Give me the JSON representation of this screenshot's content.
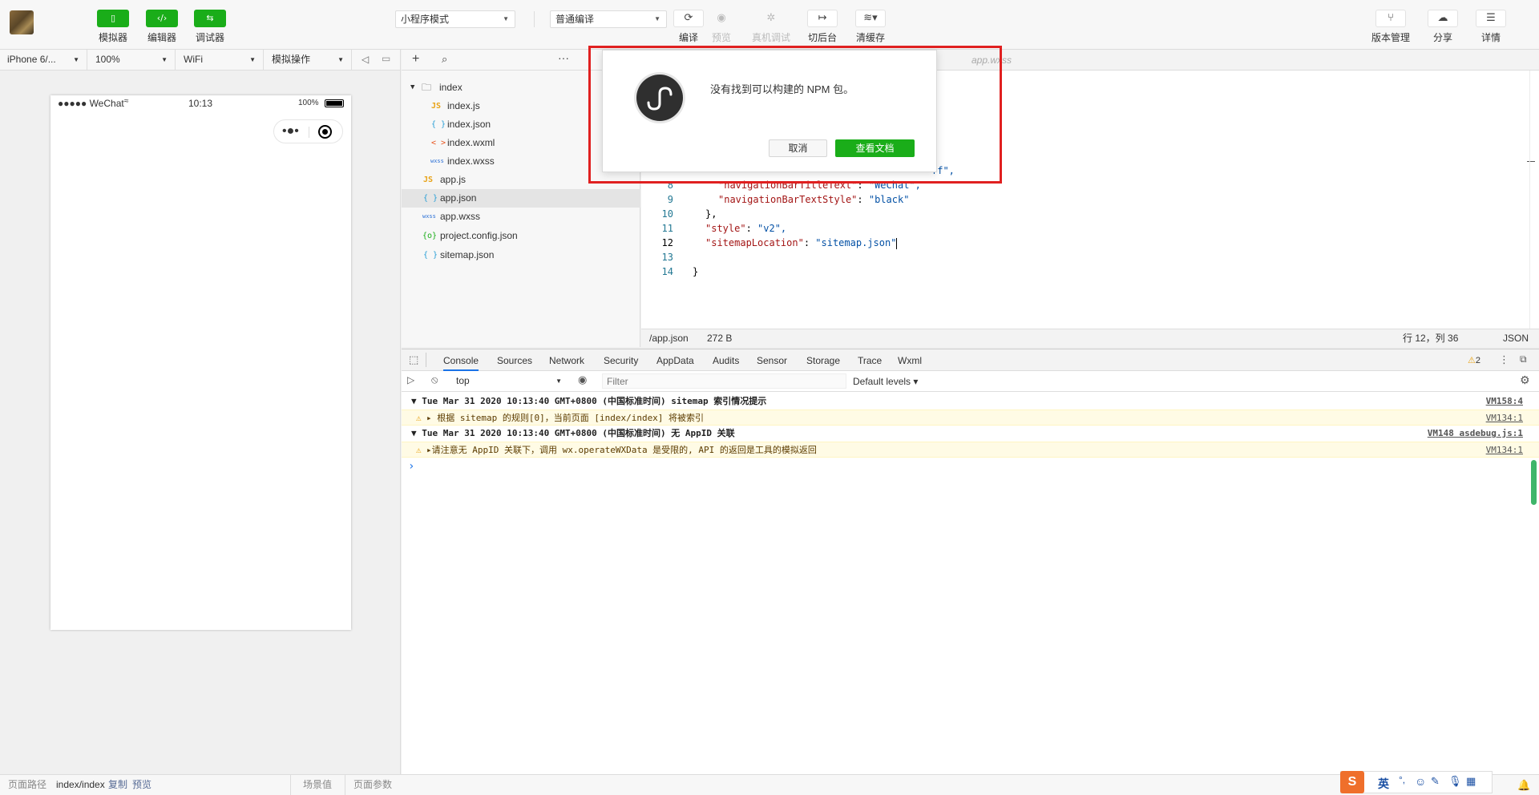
{
  "toolbar": {
    "simulator_label": "模拟器",
    "editor_label": "编辑器",
    "debugger_label": "调试器",
    "mode_select": "小程序模式",
    "compile_select": "普通编译",
    "compile_label": "编译",
    "preview_label": "预览",
    "remote_debug_label": "真机调试",
    "background_label": "切后台",
    "clear_cache_label": "清缓存",
    "version_label": "版本管理",
    "share_label": "分享",
    "details_label": "详情"
  },
  "simulator": {
    "device": "iPhone 6/...",
    "zoom": "100%",
    "network": "WiFi",
    "operation": "模拟操作",
    "status_carrier": "●●●●● WeChat",
    "status_time": "10:13",
    "status_battery": "100%"
  },
  "filetree": {
    "items": [
      {
        "name": "index",
        "icon": "folder-icon"
      },
      {
        "name": "index.js",
        "icon": "JS"
      },
      {
        "name": "index.json",
        "icon": "{ }"
      },
      {
        "name": "index.wxml",
        "icon": "< >"
      },
      {
        "name": "index.wxss",
        "icon": "wxss"
      },
      {
        "name": "app.js",
        "icon": "JS"
      },
      {
        "name": "app.json",
        "icon": "{ }"
      },
      {
        "name": "app.wxss",
        "icon": "wxss"
      },
      {
        "name": "project.config.json",
        "icon": "{o}"
      },
      {
        "name": "sitemap.json",
        "icon": "{ }"
      }
    ]
  },
  "editor": {
    "tab_ghost": "app.wxss",
    "line_numbers": [
      "8",
      "9",
      "10",
      "11",
      "12",
      "13",
      "14"
    ],
    "line7_tail": "ff\",",
    "line8_key": "\"navigationBarTitleText\"",
    "line8_val": "\"WeChat\",",
    "line9_key": "\"navigationBarTextStyle\"",
    "line9_val": "\"black\"",
    "line10": "},",
    "line11_key": "\"style\"",
    "line11_val": "\"v2\",",
    "line12_key": "\"sitemapLocation\"",
    "line12_val": "\"sitemap.json\"",
    "line14": "}",
    "status_path": "/app.json",
    "status_size": "272 B",
    "status_pos": "行 12，列 36",
    "status_lang": "JSON"
  },
  "devtools": {
    "tabs": [
      "Console",
      "Sources",
      "Network",
      "Security",
      "AppData",
      "Audits",
      "Sensor",
      "Storage",
      "Trace",
      "Wxml"
    ],
    "warn_count": "2",
    "context": "top",
    "filter_placeholder": "Filter",
    "levels": "Default levels ▾"
  },
  "console": {
    "rows": [
      {
        "text": "▼ Tue Mar 31 2020 10:13:40 GMT+0800 (中国标准时间) sitemap 索引情况提示",
        "src": "VM158:4"
      },
      {
        "text": "▸ 根据 sitemap 的规则[0]，当前页面 [index/index] 将被索引",
        "src": "VM134:1"
      },
      {
        "text": "▼ Tue Mar 31 2020 10:13:40 GMT+0800 (中国标准时间) 无 AppID 关联",
        "src": "VM148 asdebug.js:1"
      },
      {
        "text": "▸请注意无 AppID 关联下，调用 wx.operateWXData 是受限的, API 的返回是工具的模拟返回",
        "src": "VM134:1"
      }
    ],
    "prompt": "›"
  },
  "dialog": {
    "message": "没有找到可以构建的 NPM 包。",
    "cancel": "取消",
    "view_docs": "查看文档"
  },
  "footer": {
    "page_path_label": "页面路径",
    "page_path": "index/index",
    "copy": "复制",
    "preview": "预览",
    "scene": "场景值",
    "params": "页面参数"
  },
  "ime": {
    "lang": "英"
  },
  "colors": {
    "brand_green": "#1aad19",
    "highlight_red": "#e02020",
    "warn_bg": "#fffbe5"
  }
}
